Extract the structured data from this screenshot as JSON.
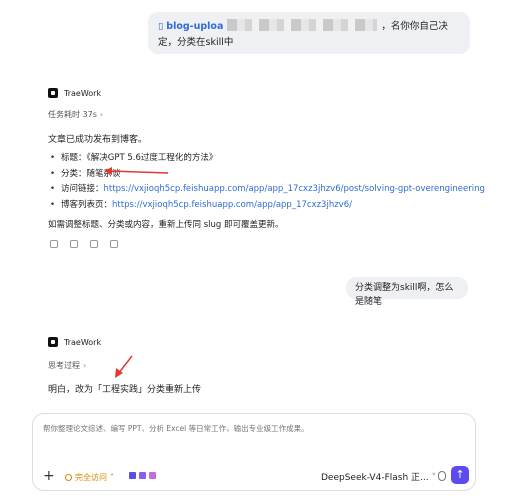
{
  "user_messages": [
    {
      "file_name": "blog-uploa",
      "text": "，名你你自己决定，分类在skill中"
    },
    {
      "text": "分类调整为skill啊，怎么是随笔"
    }
  ],
  "reply1": {
    "app_name": "TraeWork",
    "meta": "任务耗时 37s",
    "intro": "文章已成功发布到博客。",
    "items": [
      {
        "label": "标题：",
        "value": "《解决GPT 5.6过度工程化的方法》"
      },
      {
        "label": "分类：",
        "value": "随笔杂谈"
      },
      {
        "label": "访问链接：",
        "value": "https://vxjioqh5cp.feishuapp.com/app/app_17cxz3jhzv6/post/solving-gpt-overengineering"
      },
      {
        "label": "博客列表页：",
        "value": "https://vxjioqh5cp.feishuapp.com/app/app_17cxz3jhzv6/"
      }
    ],
    "footer": "如需调整标题、分类或内容，重新上传同 slug 即可覆盖更新。"
  },
  "reply2": {
    "app_name": "TraeWork",
    "meta": "思考过程",
    "text": "明白，改为「工程实践」分类重新上传"
  },
  "composer": {
    "placeholder": "帮你整理论文综述、编写 PPT、分析 Excel 等日常工作，输出专业级工作成果。",
    "access_label": "完全访问",
    "model": "DeepSeek-V4-Flash 正..."
  },
  "colors": {
    "link": "#2f6bd8",
    "accent": "#5b4bf0",
    "warning": "#d48a00",
    "annotation": "#e03a2f"
  }
}
